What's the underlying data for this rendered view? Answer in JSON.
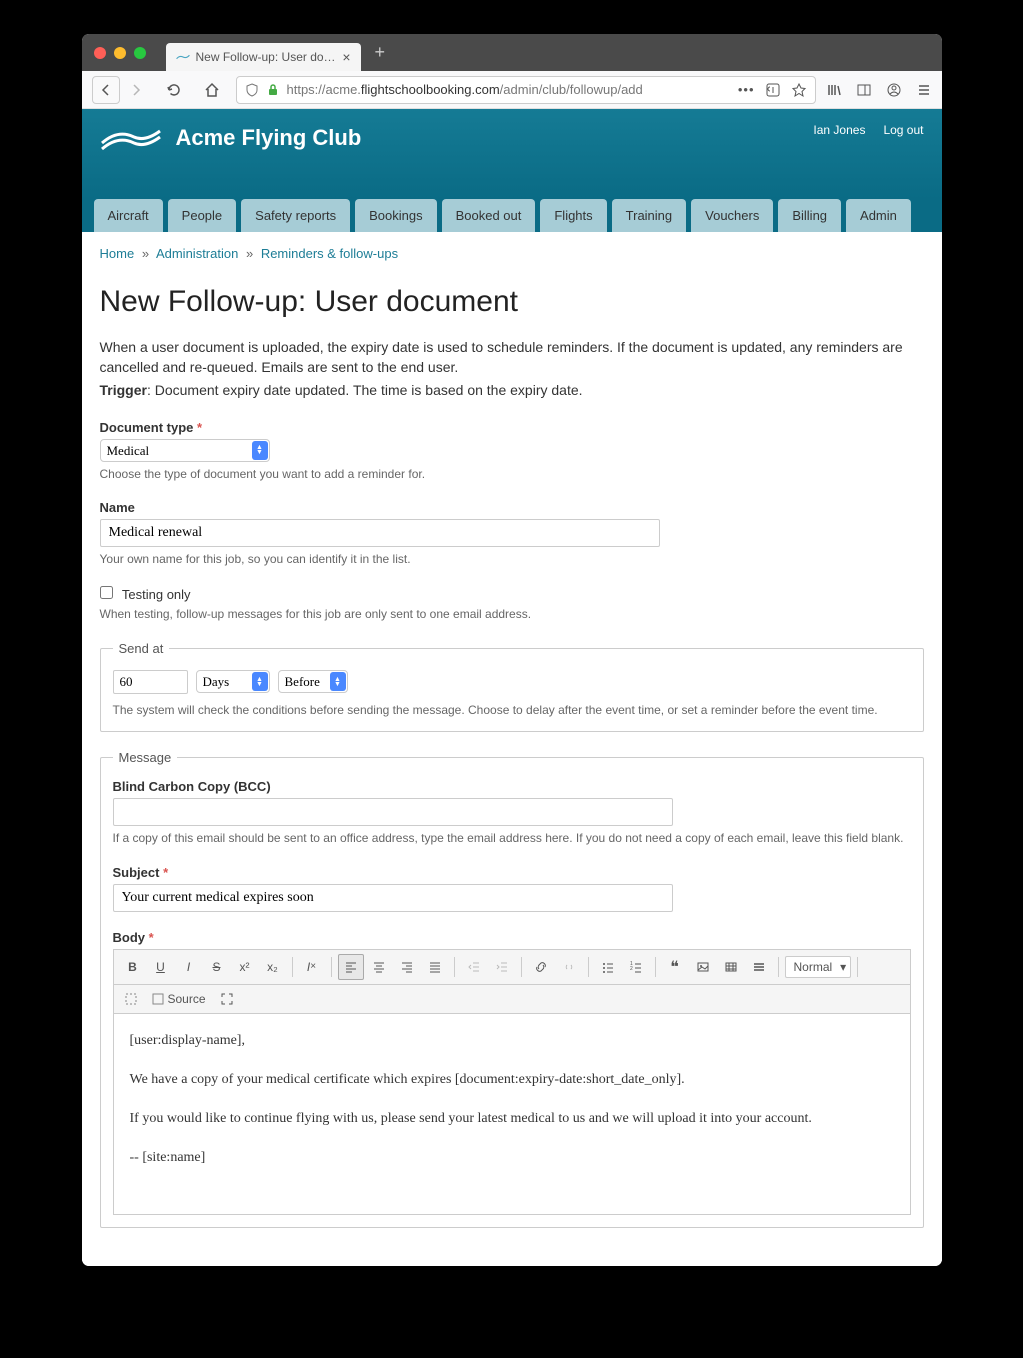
{
  "browser": {
    "tab_title": "New Follow-up: User document",
    "url_prefix": "https://acme.",
    "url_domain": "flightschoolbooking.com",
    "url_suffix": "/admin/club/followup/add"
  },
  "header": {
    "club_name": "Acme Flying Club",
    "user_link": "Ian Jones",
    "logout": "Log out"
  },
  "nav_tabs": [
    "Aircraft",
    "People",
    "Safety reports",
    "Bookings",
    "Booked out",
    "Flights",
    "Training",
    "Vouchers",
    "Billing",
    "Admin"
  ],
  "breadcrumb": {
    "home": "Home",
    "admin": "Administration",
    "reminders": "Reminders & follow-ups"
  },
  "page": {
    "title": "New Follow-up: User document",
    "intro": "When a user document is uploaded, the expiry date is used to schedule reminders. If the document is updated, any reminders are cancelled and re-queued. Emails are sent to the end user.",
    "trigger_label": "Trigger",
    "trigger_text": ": Document expiry date updated. The time is based on the expiry date."
  },
  "doc_type": {
    "label": "Document type",
    "value": "Medical",
    "help": "Choose the type of document you want to add a reminder for."
  },
  "name": {
    "label": "Name",
    "value": "Medical renewal",
    "help": "Your own name for this job, so you can identify it in the list."
  },
  "testing": {
    "label": "Testing only",
    "help": "When testing, follow-up messages for this job are only sent to one email address."
  },
  "sendat": {
    "legend": "Send at",
    "value": "60",
    "unit": "Days",
    "when": "Before",
    "help": "The system will check the conditions before sending the message. Choose to delay after the event time, or set a reminder before the event time."
  },
  "message": {
    "legend": "Message",
    "bcc_label": "Blind Carbon Copy (BCC)",
    "bcc_value": "",
    "bcc_help": "If a copy of this email should be sent to an office address, type the email address here. If you do not need a copy of each email, leave this field blank.",
    "subject_label": "Subject",
    "subject_value": "Your current medical expires soon",
    "body_label": "Body",
    "format_label": "Normal",
    "source_label": "Source",
    "body_lines": {
      "l1": "[user:display-name],",
      "l2": "We have a copy of your medical certificate which expires [document:expiry-date:short_date_only].",
      "l3": "If you would like to continue flying with us, please send your latest medical to us and we will upload it into your account.",
      "l4": "-- [site:name]"
    }
  }
}
